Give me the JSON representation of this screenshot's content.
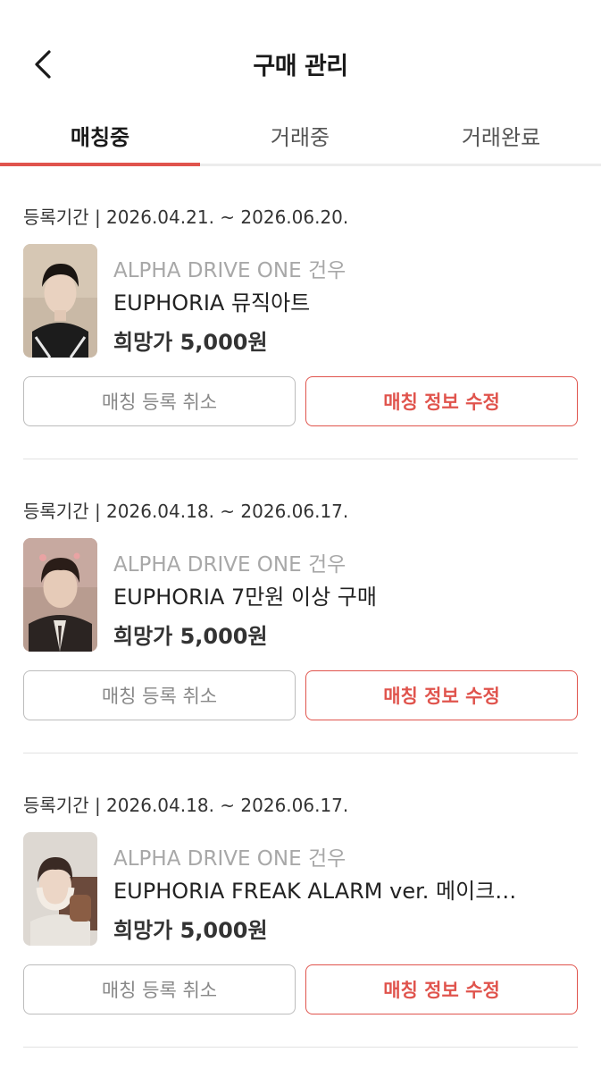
{
  "header": {
    "title": "구매 관리",
    "back_icon": "chevron-left-icon"
  },
  "tabs": [
    {
      "label": "매칭중",
      "active": true
    },
    {
      "label": "거래중",
      "active": false
    },
    {
      "label": "거래완료",
      "active": false
    }
  ],
  "colors": {
    "accent": "#e0544d",
    "muted_text": "#a8a8a8",
    "border": "#bcbcbc"
  },
  "items": [
    {
      "period": "등록기간 | 2026.04.21. ~ 2026.06.20.",
      "group": "ALPHA DRIVE ONE 건우",
      "name": "EUPHORIA 뮤직아트",
      "price": "희망가 5,000원",
      "cancel_label": "매칭 등록 취소",
      "edit_label": "매칭 정보 수정"
    },
    {
      "period": "등록기간 | 2026.04.18. ~ 2026.06.17.",
      "group": "ALPHA DRIVE ONE 건우",
      "name": "EUPHORIA 7만원 이상 구매",
      "price": "희망가 5,000원",
      "cancel_label": "매칭 등록 취소",
      "edit_label": "매칭 정보 수정"
    },
    {
      "period": "등록기간 | 2026.04.18. ~ 2026.06.17.",
      "group": "ALPHA DRIVE ONE 건우",
      "name": "EUPHORIA FREAK ALARM ver. 메이크…",
      "price": "희망가 5,000원",
      "cancel_label": "매칭 등록 취소",
      "edit_label": "매칭 정보 수정"
    }
  ]
}
